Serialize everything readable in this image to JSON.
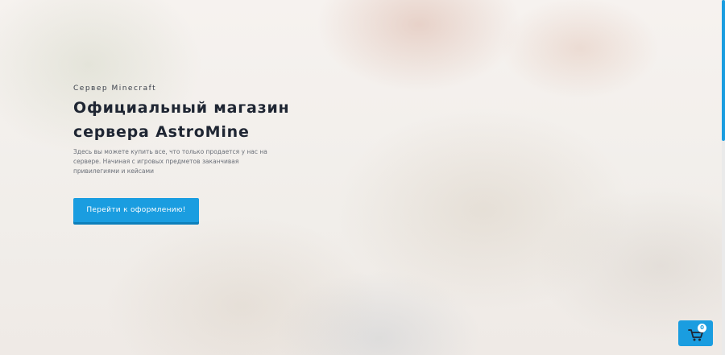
{
  "hero": {
    "eyebrow": "Сервер Minecraft",
    "title_line1": "Официальный магазин",
    "title_line2": "сервера AstroMine",
    "description": "Здесь вы можете купить все, что только продается у нас на сервере. Начиная с игровых предметов заканчивая привилегиями и кейсами",
    "cta_label": "Перейти к оформлению!"
  },
  "cart": {
    "icon": "cart-icon",
    "count": "0"
  },
  "colors": {
    "accent": "#1a9de0",
    "title": "#1f2633",
    "text": "#6b7079"
  }
}
